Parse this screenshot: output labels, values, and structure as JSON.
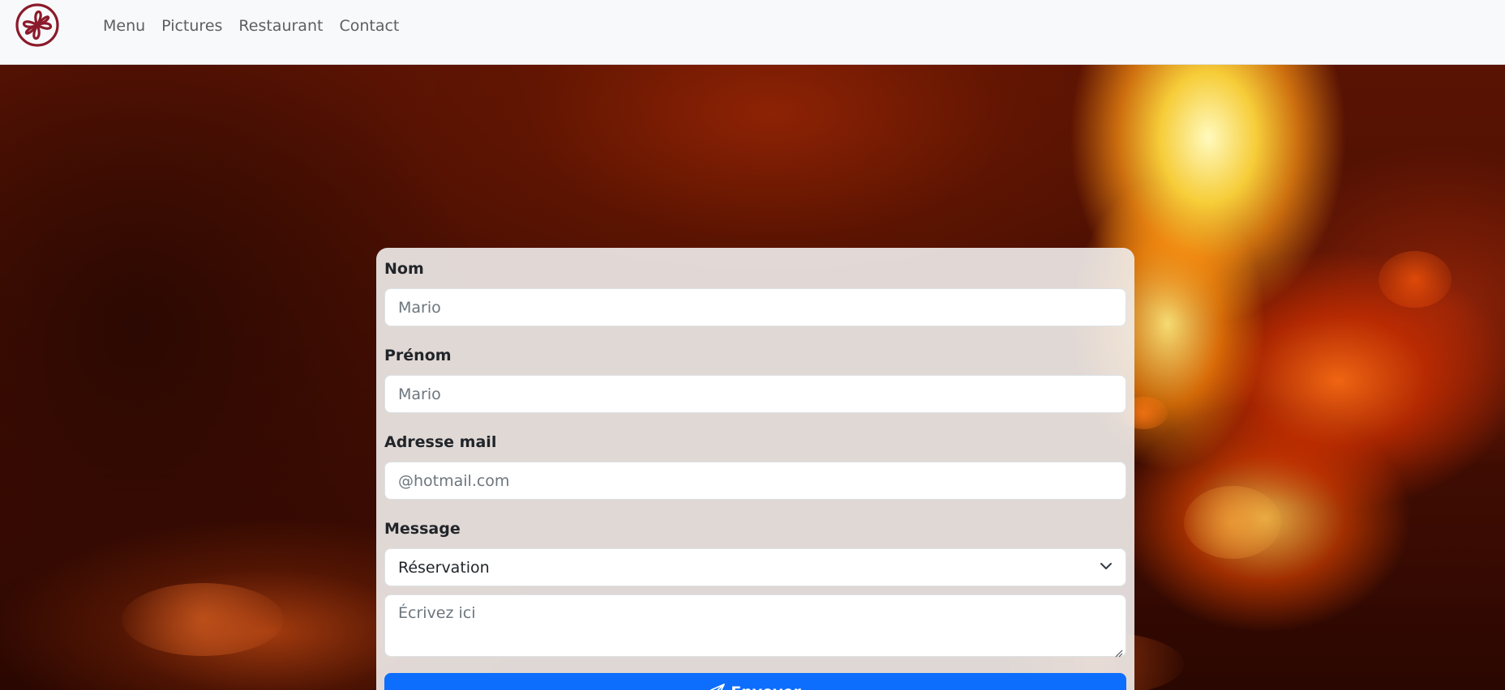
{
  "navbar": {
    "logo_icon": "flower-logo-icon",
    "links": [
      "Menu",
      "Pictures",
      "Restaurant",
      "Contact"
    ]
  },
  "form": {
    "nom": {
      "label": "Nom",
      "placeholder": "Mario"
    },
    "prenom": {
      "label": "Prénom",
      "placeholder": "Mario"
    },
    "email": {
      "label": "Adresse mail",
      "placeholder": "@hotmail.com"
    },
    "message": {
      "label": "Message",
      "selected": "Réservation",
      "textarea_placeholder": "Écrivez ici"
    },
    "submit": {
      "label": "Envoyer",
      "icon": "send-icon"
    }
  },
  "colors": {
    "primary": "#0d6efd",
    "logo": "#8b1a2b",
    "navbar_bg": "#f8f9fa"
  }
}
